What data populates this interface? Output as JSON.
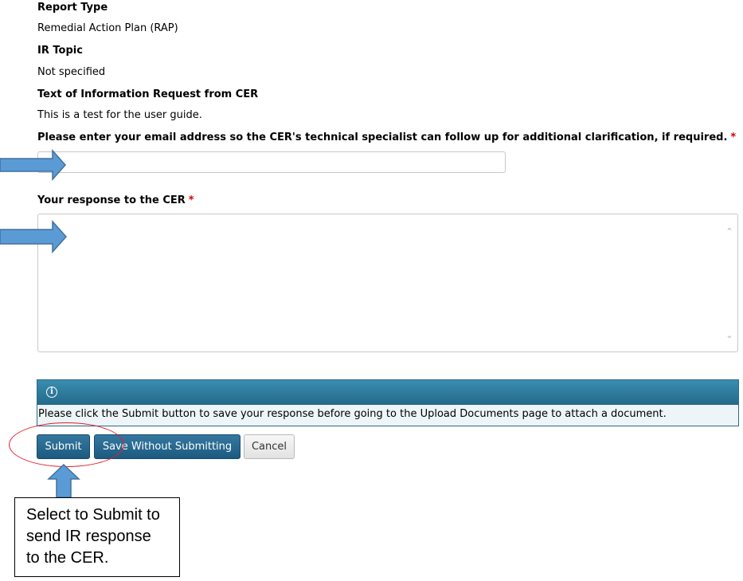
{
  "details": {
    "report_type_label": "Report Type",
    "report_type_value": "Remedial Action Plan (RAP)",
    "ir_topic_label": "IR Topic",
    "ir_topic_value": "Not specified",
    "request_text_label": "Text of Information Request from CER",
    "request_text_value": "This is a test for the user guide."
  },
  "form": {
    "email_label": "Please enter your email address so the CER's technical specialist can follow up for additional clarification, if required.",
    "email_value": "",
    "response_label": "Your response to the CER",
    "response_value": "",
    "required_marker": "*"
  },
  "info": {
    "icon": "info-icon",
    "icon_glyph": "i",
    "message": "Please click the Submit button to save your response before going to the Upload Documents page to attach a document."
  },
  "buttons": {
    "submit": "Submit",
    "save_without_submitting": "Save Without Submitting",
    "cancel": "Cancel"
  },
  "annotation": {
    "callout_line1": "Select to Submit to",
    "callout_line2": "send IR response",
    "callout_line3": "to the CER.",
    "arrow_color": "#5b9bd5",
    "arrow_outline": "#41719c",
    "ellipse_color": "#e0202a"
  },
  "colors": {
    "primary_button": "#1d5a80",
    "info_header": "#2a7499",
    "required": "#cc0000"
  }
}
